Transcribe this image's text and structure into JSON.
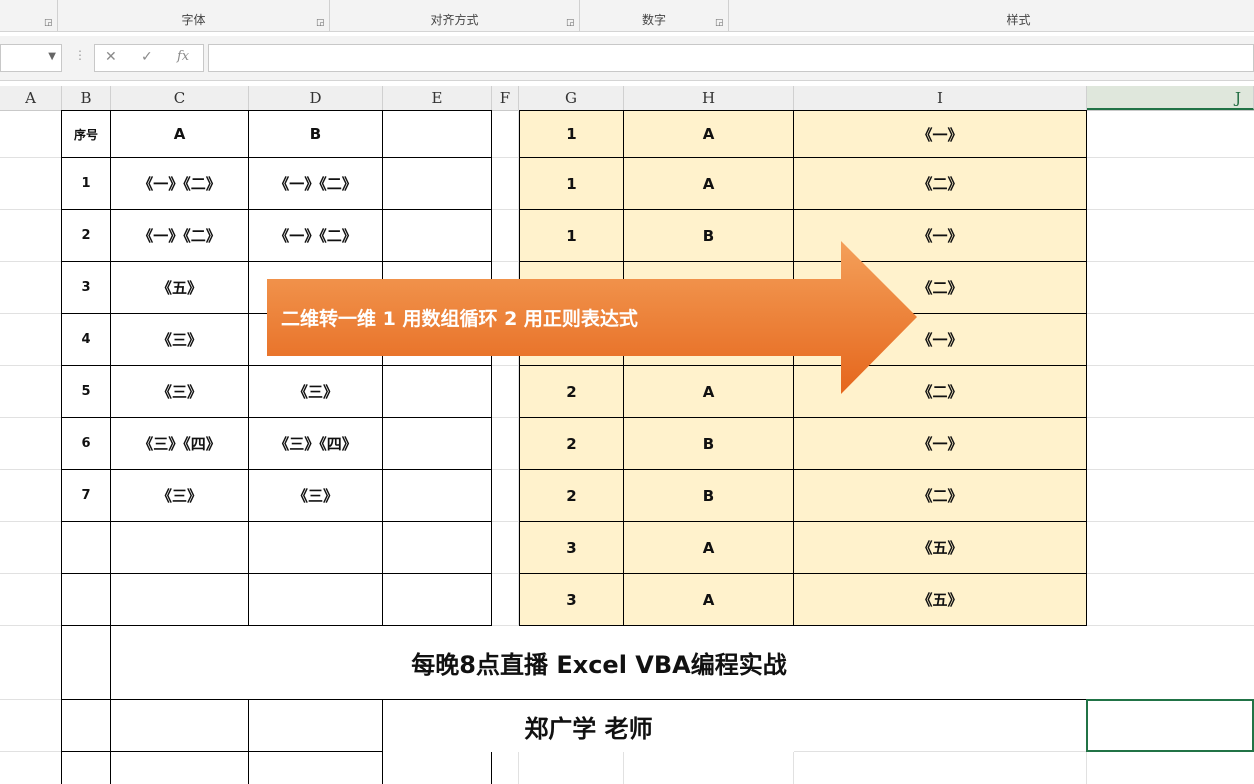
{
  "ribbon": {
    "groups": [
      {
        "label": ""
      },
      {
        "label": "字体"
      },
      {
        "label": "对齐方式"
      },
      {
        "label": "数字"
      },
      {
        "label": "样式"
      }
    ]
  },
  "formula_bar": {
    "name_box": "",
    "cancel_icon": "✕",
    "enter_icon": "✓",
    "fx_label": "fx",
    "content": ""
  },
  "columns": [
    "A",
    "B",
    "C",
    "D",
    "E",
    "F",
    "G",
    "H",
    "I",
    "J"
  ],
  "left_table": {
    "headers": [
      "序号",
      "A",
      "B"
    ],
    "rows": [
      [
        "1",
        "《一》《二》",
        "《一》《二》"
      ],
      [
        "2",
        "《一》《二》",
        "《一》《二》"
      ],
      [
        "3",
        "《五》",
        ""
      ],
      [
        "4",
        "《三》",
        ""
      ],
      [
        "5",
        "《三》",
        "《三》"
      ],
      [
        "6",
        "《三》《四》",
        "《三》《四》"
      ],
      [
        "7",
        "《三》",
        "《三》"
      ]
    ]
  },
  "right_table": {
    "rows": [
      [
        "1",
        "A",
        "《一》"
      ],
      [
        "1",
        "A",
        "《二》"
      ],
      [
        "1",
        "B",
        "《一》"
      ],
      [
        "",
        "",
        "《二》"
      ],
      [
        "",
        "",
        "《一》"
      ],
      [
        "2",
        "A",
        "《二》"
      ],
      [
        "2",
        "B",
        "《一》"
      ],
      [
        "2",
        "B",
        "《二》"
      ],
      [
        "3",
        "A",
        "《五》"
      ],
      [
        "3",
        "A",
        "《五》"
      ]
    ]
  },
  "banner_text": "二维转一维  1 用数组循环  2 用正则表达式",
  "promo": {
    "line1": "每晚8点直播 Excel VBA编程实战",
    "line2": "郑广学 老师"
  },
  "colors": {
    "cream_fill": "#fff2cc",
    "arrow_fill": "#ed7d31",
    "selection": "#217346"
  }
}
